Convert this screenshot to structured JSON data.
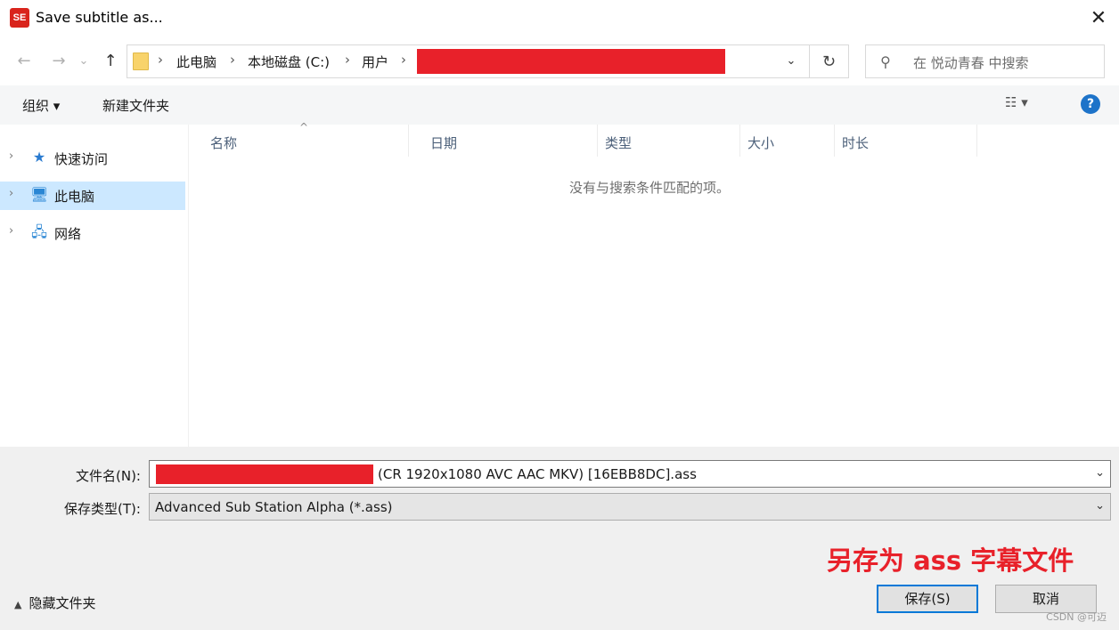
{
  "window": {
    "app_icon_text": "SE",
    "title": "Save subtitle as...",
    "close_glyph": "✕"
  },
  "nav": {
    "back_glyph": "←",
    "forward_glyph": "→",
    "recent_glyph": "⌄",
    "up_glyph": "↑",
    "breadcrumbs": [
      "此电脑",
      "本地磁盘 (C:)",
      "用户"
    ],
    "crumb_separator": "›",
    "addr_dropdown_glyph": "⌄",
    "refresh_glyph": "↻",
    "search_placeholder": "在 悦动青春 中搜索",
    "search_icon": "search-icon"
  },
  "toolbar": {
    "organize_label": "组织 ▾",
    "new_folder_label": "新建文件夹",
    "view_label": "☷ ▾",
    "help_label": "?"
  },
  "sidebar": {
    "items": [
      {
        "label": "快速访问",
        "icon": "★",
        "selected": false
      },
      {
        "label": "此电脑",
        "icon": "🖥",
        "selected": true
      },
      {
        "label": "网络",
        "icon": "🖧",
        "selected": false
      }
    ]
  },
  "filelist": {
    "columns": [
      "名称",
      "日期",
      "类型",
      "大小",
      "时长"
    ],
    "sort_glyph": "^",
    "empty_message": "没有与搜索条件匹配的项。"
  },
  "form": {
    "filename_label": "文件名(N):",
    "filename_value": "(CR 1920x1080 AVC AAC MKV) [16EBB8DC].ass",
    "filetype_label": "保存类型(T):",
    "filetype_value": "Advanced Sub Station Alpha (*.ass)",
    "dropdown_glyph": "⌄"
  },
  "annotation_text": "另存为 ass 字幕文件",
  "footer": {
    "hide_folders_label": "隐藏文件夹",
    "hide_caret": "▲",
    "save_button": "保存(S)",
    "cancel_button": "取消",
    "watermark": "CSDN @可迈"
  },
  "colors": {
    "accent": "#0078d7",
    "redaction": "#e8212a",
    "selection": "#cce8ff"
  }
}
